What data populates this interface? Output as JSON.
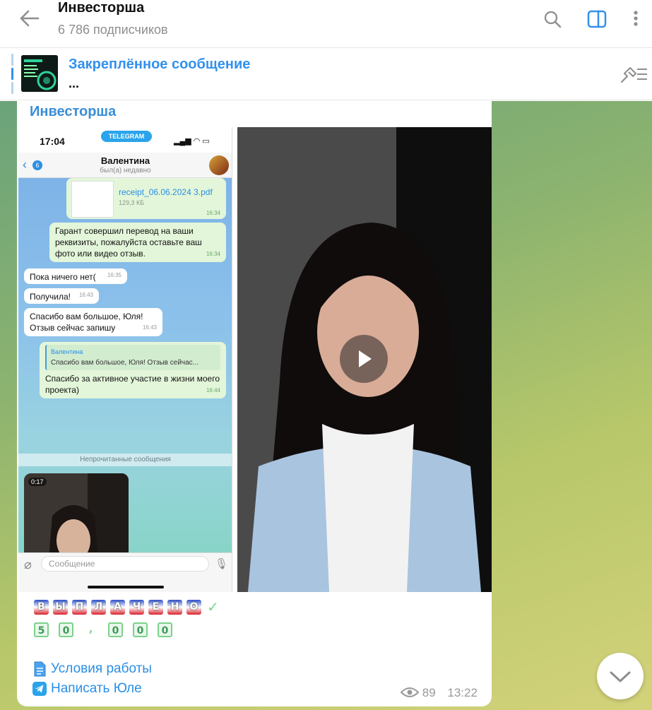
{
  "header": {
    "title": "Инвесторша",
    "subscribers": "6 786 подписчиков"
  },
  "pinned": {
    "title": "Закреплённое сообщение",
    "text": "..."
  },
  "message": {
    "sender": "Инвесторша",
    "emoji_row_1": [
      "В",
      "Ы",
      "П",
      "Л",
      "А",
      "Ч",
      "Е",
      "Н",
      "О",
      "✓"
    ],
    "emoji_row_2": [
      "5",
      "0",
      ",",
      "0",
      "0",
      "0"
    ],
    "links": [
      {
        "label": "Условия работы",
        "icon": "document-icon"
      },
      {
        "label": "Написать Юле",
        "icon": "telegram-icon"
      }
    ],
    "views": "89",
    "time": "13:22"
  },
  "phone": {
    "status_time": "17:04",
    "status_pill": "TELEGRAM",
    "back_count": "6",
    "contact_name": "Валентина",
    "contact_status": "был(а) недавно",
    "file_name": "receipt_06.06.2024 3.pdf",
    "file_size": "129,3 КБ",
    "file_time": "16:34",
    "messages": [
      {
        "text": "Гарант совершил перевод на ваши реквизиты, пожалуйста оставьте ваш фото или видео отзыв.",
        "time": "16:34",
        "out": true
      },
      {
        "text": "Пока ничего нет(",
        "time": "16:35",
        "out": false
      },
      {
        "text": "Получила!",
        "time": "16:43",
        "out": false
      },
      {
        "text": "Спасибо вам большое, Юля! Отзыв сейчас запишу",
        "time": "16:43",
        "out": false
      }
    ],
    "reply": {
      "quoted_name": "Валентина",
      "quoted_text": "Спасибо вам большое, Юля! Отзыв сейчас...",
      "text": "Спасибо за активное участие в жизни моего проекта)",
      "time": "16:44"
    },
    "unread_label": "Непрочитанные сообщения",
    "video_duration": "0:17",
    "input_placeholder": "Сообщение"
  },
  "colors": {
    "accent": "#3390ec",
    "link": "#2a8fe6",
    "pinned_bar": "#b7d3ee"
  }
}
